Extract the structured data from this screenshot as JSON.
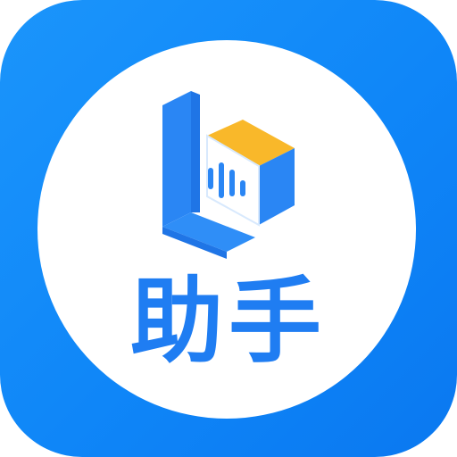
{
  "app": {
    "label": "助手"
  },
  "icons": {
    "logo": "cube-voice-logo-icon"
  },
  "colors": {
    "tile_start": "#1b95fb",
    "tile_end": "#0a78f0",
    "circle": "#ffffff",
    "logo_blue": "#2a86f4",
    "logo_blue_dark": "#1f75e6",
    "cube_top": "#f9b82a",
    "label": "#1f7df2"
  }
}
